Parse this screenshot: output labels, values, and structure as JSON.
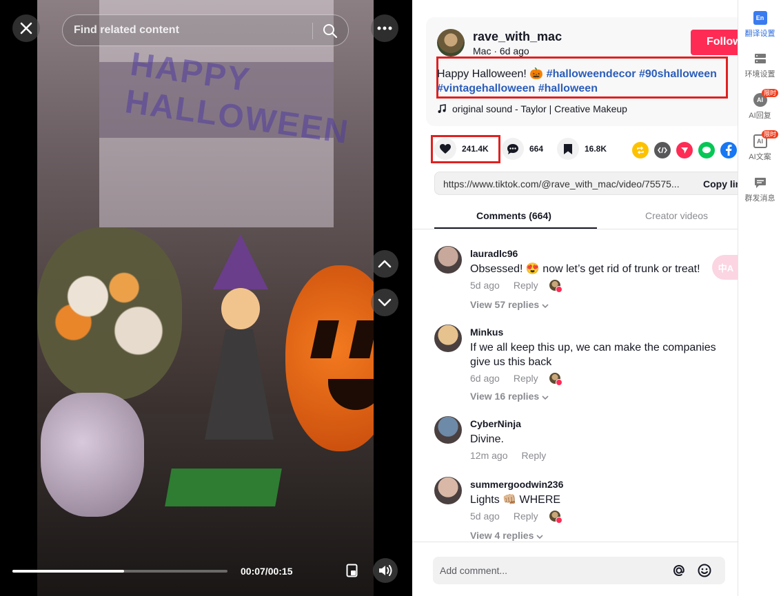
{
  "video": {
    "close_icon": "close-icon",
    "search_placeholder": "Find related content",
    "more_icon": "more-icon",
    "time": "00:07/00:15",
    "progress": 0.52,
    "overlay_text": "HAPPY HALLOWEEN"
  },
  "post": {
    "author": "rave_with_mac",
    "author_sub": "Mac · 6d ago",
    "follow_label": "Follow",
    "caption_text": "Happy Halloween! 🎃",
    "tags": [
      "#halloweendecor",
      "#90shalloween",
      "#vintagehalloween",
      "#halloween"
    ],
    "music": "original sound - Taylor | Creative Makeup",
    "likes": "241.4K",
    "comments": "664",
    "saves": "16.8K",
    "link": "https://www.tiktok.com/@rave_with_mac/video/75575...",
    "copy_link_label": "Copy link"
  },
  "tabs": [
    {
      "label": "Comments (664)",
      "active": true
    },
    {
      "label": "Creator videos",
      "active": false
    }
  ],
  "comments": [
    {
      "user": "lauradlc96",
      "text": "Obsessed! 😍 now let’s get rid of trunk or treat!",
      "time": "5d ago",
      "reply": "Reply",
      "view": "View 57 replies",
      "avatar_color": "#c7a89a"
    },
    {
      "user": "Minkus",
      "text": "If we all keep this up, we can make the companies give us this back",
      "time": "6d ago",
      "reply": "Reply",
      "view": "View 16 replies",
      "avatar_color": "#e6c28e"
    },
    {
      "user": "CyberNinja",
      "text": "Divine.",
      "time": "12m ago",
      "reply": "Reply",
      "view": "",
      "avatar_color": "#6d8aa8"
    },
    {
      "user": "summergoodwin236",
      "text": "Lights 👊🏼 WHERE",
      "time": "5d ago",
      "reply": "Reply",
      "view": "View 4 replies",
      "avatar_color": "#d9b8a8"
    }
  ],
  "add_comment_placeholder": "Add comment...",
  "sidebar": [
    {
      "label": "翻译设置",
      "icon": "translate-settings-icon",
      "icon_text": "En",
      "badge": "",
      "active": true
    },
    {
      "label": "环境设置",
      "icon": "environment-settings-icon",
      "icon_text": "",
      "badge": "",
      "active": false
    },
    {
      "label": "AI回复",
      "icon": "ai-reply-icon",
      "icon_text": "AI",
      "badge": "限时",
      "active": false
    },
    {
      "label": "AI文案",
      "icon": "ai-copywriting-icon",
      "icon_text": "AI",
      "badge": "限时",
      "active": false
    },
    {
      "label": "群发消息",
      "icon": "mass-message-icon",
      "icon_text": "",
      "badge": "",
      "active": false
    }
  ],
  "translate_fab_text": "中A",
  "colors": {
    "accent": "#fe2c55",
    "hashtag": "#2b5db9",
    "highlight_box": "#e02020"
  }
}
